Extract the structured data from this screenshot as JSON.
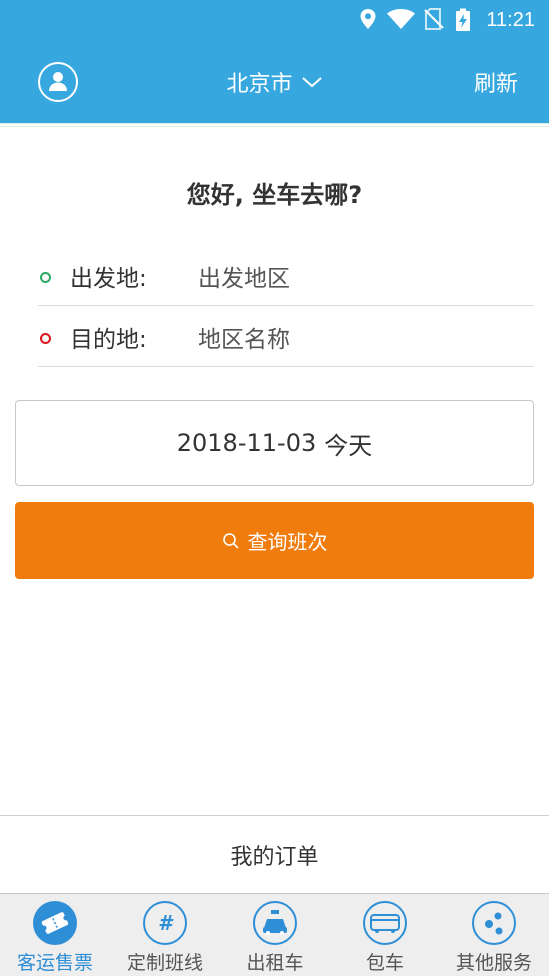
{
  "status_bar": {
    "time": "11:21",
    "icons": [
      "location-icon",
      "wifi-icon",
      "no-sim-icon",
      "battery-charging-icon"
    ]
  },
  "header": {
    "city": "北京市",
    "refresh_label": "刷新",
    "avatar_icon": "user-icon",
    "city_dropdown_icon": "chevron-down-icon",
    "bg_color": "#36a7df"
  },
  "main": {
    "greeting": "您好, 坐车去哪?",
    "departure": {
      "label": "出发地:",
      "value": "出发地区"
    },
    "destination": {
      "label": "目的地:",
      "value": "地区名称"
    },
    "date": {
      "value": "2018-11-03",
      "day_label": "今天"
    },
    "search_button": {
      "label": "查询班次",
      "icon": "search-icon",
      "color": "#f07c0e"
    }
  },
  "orders": {
    "label": "我的订单"
  },
  "tabbar": {
    "active_color": "#2f8fd6",
    "items": [
      {
        "label": "客运售票",
        "icon": "ticket-icon",
        "active": true
      },
      {
        "label": "定制班线",
        "icon": "custom-route-icon",
        "active": false
      },
      {
        "label": "出租车",
        "icon": "taxi-icon",
        "active": false
      },
      {
        "label": "包车",
        "icon": "bus-icon",
        "active": false
      },
      {
        "label": "其他服务",
        "icon": "share-icon",
        "active": false
      }
    ]
  }
}
